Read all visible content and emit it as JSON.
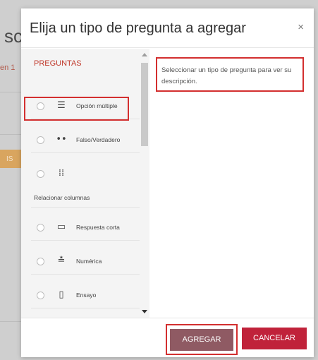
{
  "background": {
    "heading_fragment": "sc",
    "subtext_fragment": "en 1",
    "button_fragment": "IS"
  },
  "modal": {
    "title": "Elija un tipo de pregunta a agregar",
    "close_glyph": "×",
    "section_title": "PREGUNTAS",
    "questions": [
      {
        "label": "Opción múltiple",
        "icon": "list-icon",
        "glyph": "☰"
      },
      {
        "label": "Falso/Verdadero",
        "icon": "dots-icon",
        "glyph": "••"
      },
      {
        "label": "",
        "icon": "grid-icon",
        "glyph": "⁞⁞"
      },
      {
        "label": "Respuesta corta",
        "icon": "rectangle-icon",
        "glyph": "▭"
      },
      {
        "label": "Numérica",
        "icon": "numeric-icon",
        "glyph": "≛"
      },
      {
        "label": "Ensayo",
        "icon": "document-icon",
        "glyph": "▯"
      }
    ],
    "relacionar_label": "Relacionar columnas",
    "description": "Seleccionar un tipo de pregunta para ver su descripción.",
    "buttons": {
      "add": "AGREGAR",
      "cancel": "CANCELAR"
    }
  },
  "colors": {
    "accent_red": "#c0223a",
    "add_button": "#8f5a63",
    "highlight": "#d32f2f"
  }
}
